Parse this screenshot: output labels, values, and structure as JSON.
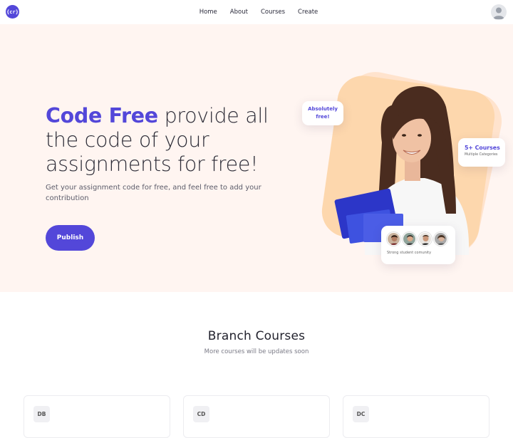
{
  "nav": {
    "logo_text": "{cr}",
    "links": [
      {
        "label": "Home"
      },
      {
        "label": "About"
      },
      {
        "label": "Courses"
      },
      {
        "label": "Create"
      }
    ],
    "avatar_icon": "user-avatar-icon"
  },
  "hero": {
    "title_brand": "Code Free",
    "title_rest": " provide all the code of your assignments for free!",
    "subtitle": "Get your assignment code for free, and feel free to add your contribution",
    "publish_label": "Publish",
    "badge_free_line1": "Absolutely",
    "badge_free_line2": "free!",
    "badge_courses_title": "5+ Courses",
    "badge_courses_sub": "Multiple Categories",
    "community_text": "Strong student comunity"
  },
  "courses_section": {
    "title": "Branch Courses",
    "subtitle": "More courses will be updates soon",
    "cards": [
      {
        "badge": "DB"
      },
      {
        "badge": "CD"
      },
      {
        "badge": "DC"
      }
    ]
  },
  "colors": {
    "brand": "#5347d9",
    "hero_bg": "#fff5f1",
    "blob": "#fdd7ad"
  }
}
